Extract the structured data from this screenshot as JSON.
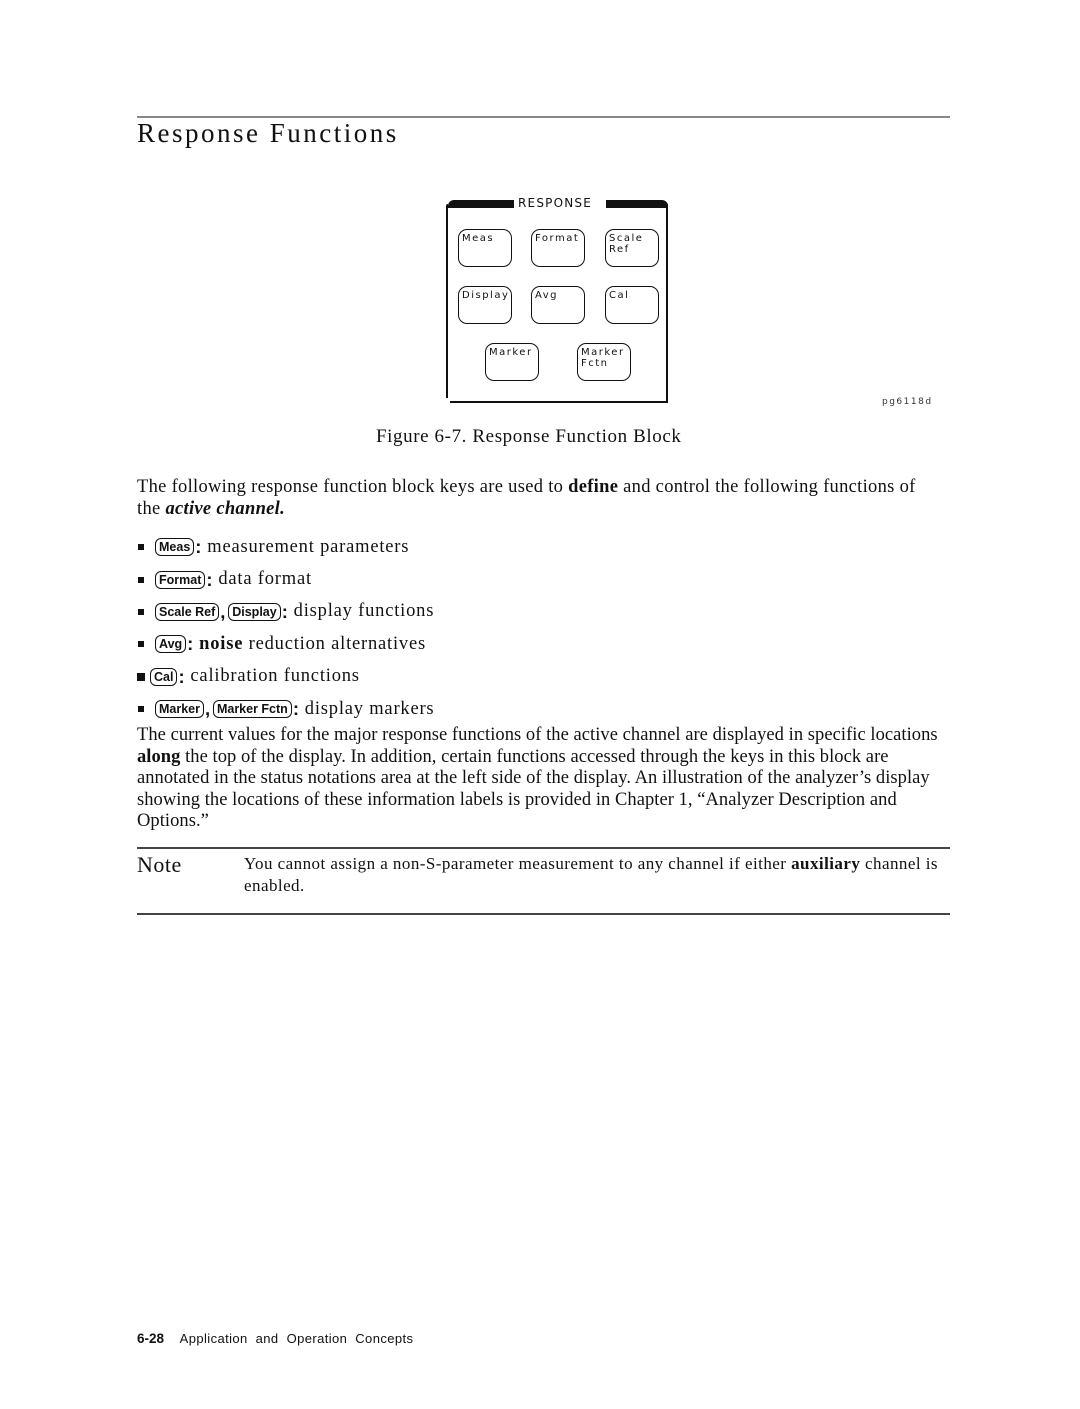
{
  "section": {
    "title": "Response Functions"
  },
  "figure": {
    "panel_title": "RESPONSE",
    "keys": [
      {
        "id": "meas",
        "label": "Meas"
      },
      {
        "id": "format",
        "label": "Format"
      },
      {
        "id": "scale-ref",
        "label": "Scale\nRef"
      },
      {
        "id": "display",
        "label": "Display"
      },
      {
        "id": "avg",
        "label": "Avg"
      },
      {
        "id": "cal",
        "label": "Cal"
      },
      {
        "id": "marker",
        "label": "Marker"
      },
      {
        "id": "marker-fctn",
        "label": "Marker\nFctn"
      }
    ],
    "code": "pg6118d",
    "caption": "Figure 6-7. Response Function Block"
  },
  "intro": {
    "before": "The following response function block keys are used to ",
    "bold": "define",
    "middle": " and control the following functions of the ",
    "bold_italic": "active channel."
  },
  "bullets": [
    {
      "keys": [
        "Meas"
      ],
      "bold_prefix": "",
      "text": "measurement parameters"
    },
    {
      "keys": [
        "Format"
      ],
      "bold_prefix": "",
      "text": "data format"
    },
    {
      "keys": [
        "Scale Ref",
        "Display"
      ],
      "bold_prefix": "",
      "text": "display functions"
    },
    {
      "keys": [
        "Avg"
      ],
      "bold_prefix": "noise",
      "text": " reduction alternatives"
    },
    {
      "keys": [
        "Cal"
      ],
      "bold_prefix": "",
      "text": "calibration functions"
    },
    {
      "keys": [
        "Marker",
        "Marker Fctn"
      ],
      "bold_prefix": "",
      "text": "display markers"
    }
  ],
  "paragraph2": {
    "before": "The current values for the major response functions of the active channel are displayed in specific locations ",
    "bold": "along",
    "after": " the top of the display. In addition, certain functions accessed through the keys in this block are annotated in the status notations area at the left side of the display. An illustration of the analyzer’s display showing the locations of these information labels is provided in Chapter 1, “Analyzer Description and Options.”"
  },
  "note": {
    "label": "Note",
    "before": "You cannot assign a non-S-parameter measurement to any channel if either ",
    "bold": "auxiliary",
    "after": " channel is enabled."
  },
  "footer": {
    "page_number": "6-28",
    "section_name": "Application and Operation Concepts"
  }
}
